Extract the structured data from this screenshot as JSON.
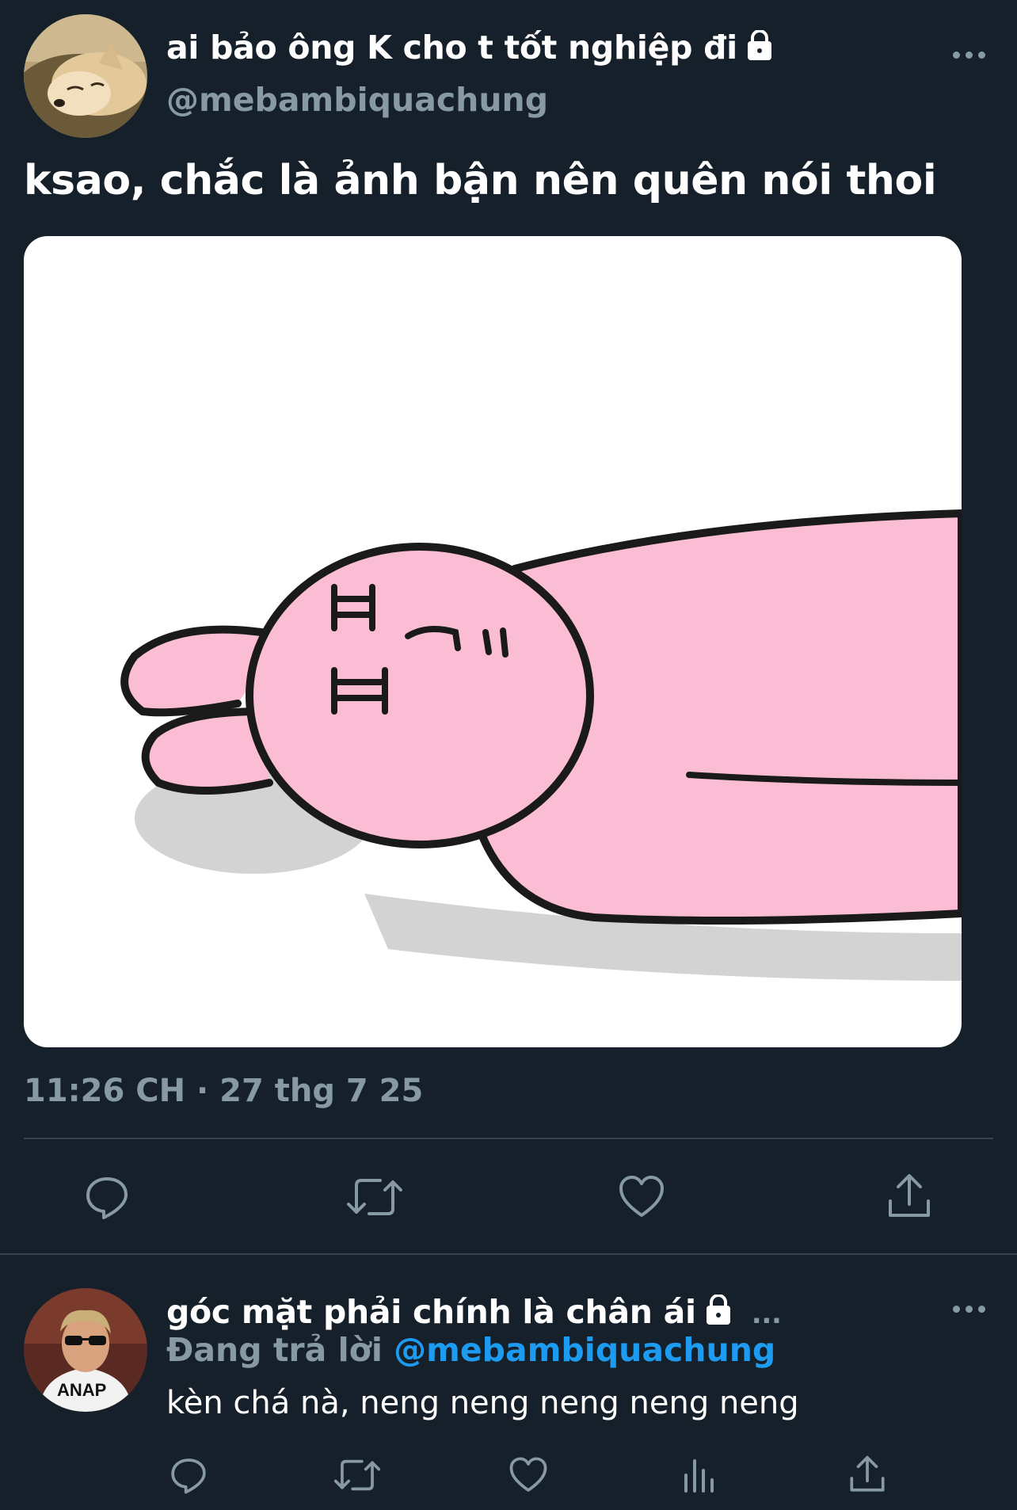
{
  "main_tweet": {
    "display_name": "ai bảo ông K cho t tốt nghiệp đi",
    "handle": "@mebambiquachung",
    "text": "ksao, chắc là ảnh bận nên quên nói thoi",
    "time": "11:26 CH",
    "separator": "·",
    "date": "27 thg 7 25",
    "actions": [
      "reply-icon",
      "retweet-icon",
      "like-icon",
      "share-icon"
    ]
  },
  "reply_tweet": {
    "display_name": "góc mặt phải chính là chân ái",
    "ellipsis": "...",
    "replying_prefix": "Đang trả lời",
    "replying_handle": "@mebambiquachung",
    "text": "kèn chá nà, neng neng neng neng neng",
    "actions": [
      "reply-icon",
      "retweet-icon",
      "like-icon",
      "analytics-icon",
      "share-icon"
    ]
  },
  "colors": {
    "background": "#15202b",
    "text": "#ffffff",
    "muted": "#8899a6",
    "accent": "#1d9bf0",
    "divider": "#38444d",
    "bunny_pink": "#fbbdd4"
  }
}
